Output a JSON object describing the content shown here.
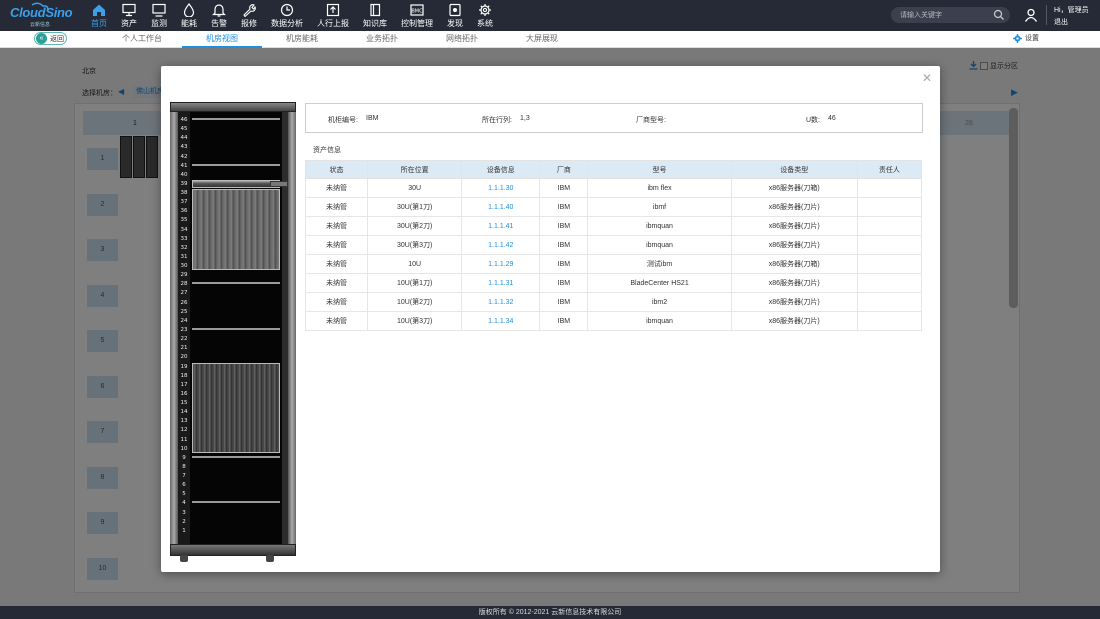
{
  "app": {
    "logo_text": "CloudSino",
    "logo_sub": "云新信息"
  },
  "nav": {
    "items": [
      {
        "label": "首页",
        "icon": "home-icon",
        "active": true
      },
      {
        "label": "资产",
        "icon": "server-icon"
      },
      {
        "label": "监测",
        "icon": "monitor-icon"
      },
      {
        "label": "能耗",
        "icon": "energy-drop-icon"
      },
      {
        "label": "告警",
        "icon": "bell-icon"
      },
      {
        "label": "报修",
        "icon": "wrench-icon"
      },
      {
        "label": "数据分析",
        "icon": "clock-chart-icon"
      },
      {
        "label": "人行上报",
        "icon": "upload-report-icon"
      },
      {
        "label": "知识库",
        "icon": "book-icon"
      },
      {
        "label": "控制管理",
        "icon": "control-panel-icon"
      },
      {
        "label": "发现",
        "icon": "discover-icon"
      },
      {
        "label": "系统",
        "icon": "gear-icon"
      }
    ],
    "search_placeholder": "请输入关键字",
    "user_greeting": "Hi，管理员",
    "logout_label": "退出"
  },
  "subnav": {
    "back_label": "返回",
    "tabs": [
      {
        "label": "个人工作台",
        "active": false
      },
      {
        "label": "机房视图",
        "active": true
      },
      {
        "label": "机房能耗",
        "active": false
      },
      {
        "label": "业务拓扑",
        "active": false
      },
      {
        "label": "网络拓扑",
        "active": false
      },
      {
        "label": "大屏展现",
        "active": false
      }
    ],
    "settings_label": "设置"
  },
  "background": {
    "location": "北京",
    "select_room_label": "选择机房：",
    "selected_room": "佛山机房",
    "show_zone_label": "显示分区",
    "first_col": "1",
    "last_col": "28",
    "rows": [
      "1",
      "2",
      "3",
      "4",
      "5",
      "6",
      "7",
      "8",
      "9",
      "10"
    ]
  },
  "modal": {
    "rack": {
      "u_count": 46
    },
    "info": {
      "cabinet_no_label": "机柜编号:",
      "cabinet_no": "IBM",
      "row_col_label": "所在行列:",
      "row_col": "1,3",
      "vendor_model_label": "厂商型号:",
      "vendor_model": "",
      "u_count_label": "U数:",
      "u_count": "46"
    },
    "section_title": "资产信息",
    "table": {
      "headers": [
        "状态",
        "所在位置",
        "设备信息",
        "厂商",
        "型号",
        "设备类型",
        "责任人"
      ],
      "rows": [
        [
          "未纳管",
          "30U",
          "1.1.1.30",
          "IBM",
          "ibm flex",
          "x86服务器(刀箱)",
          ""
        ],
        [
          "未纳管",
          "30U(第1刀)",
          "1.1.1.40",
          "IBM",
          "ibmf",
          "x86服务器(刀片)",
          ""
        ],
        [
          "未纳管",
          "30U(第2刀)",
          "1.1.1.41",
          "IBM",
          "ibmquan",
          "x86服务器(刀片)",
          ""
        ],
        [
          "未纳管",
          "30U(第3刀)",
          "1.1.1.42",
          "IBM",
          "ibmquan",
          "x86服务器(刀片)",
          ""
        ],
        [
          "未纳管",
          "10U",
          "1.1.1.29",
          "IBM",
          "测试ibm",
          "x86服务器(刀箱)",
          ""
        ],
        [
          "未纳管",
          "10U(第1刀)",
          "1.1.1.31",
          "IBM",
          "BladeCenter HS21",
          "x86服务器(刀片)",
          ""
        ],
        [
          "未纳管",
          "10U(第2刀)",
          "1.1.1.32",
          "IBM",
          "ibm2",
          "x86服务器(刀片)",
          ""
        ],
        [
          "未纳管",
          "10U(第3刀)",
          "1.1.1.34",
          "IBM",
          "ibmquan",
          "x86服务器(刀片)",
          ""
        ]
      ]
    }
  },
  "footer": {
    "copyright": "版权所有 © 2012-2021  云新信息技术有限公司"
  },
  "colors": {
    "topbar": "#252a36",
    "accent": "#1f8fe0",
    "table_header": "#dceaf6"
  }
}
